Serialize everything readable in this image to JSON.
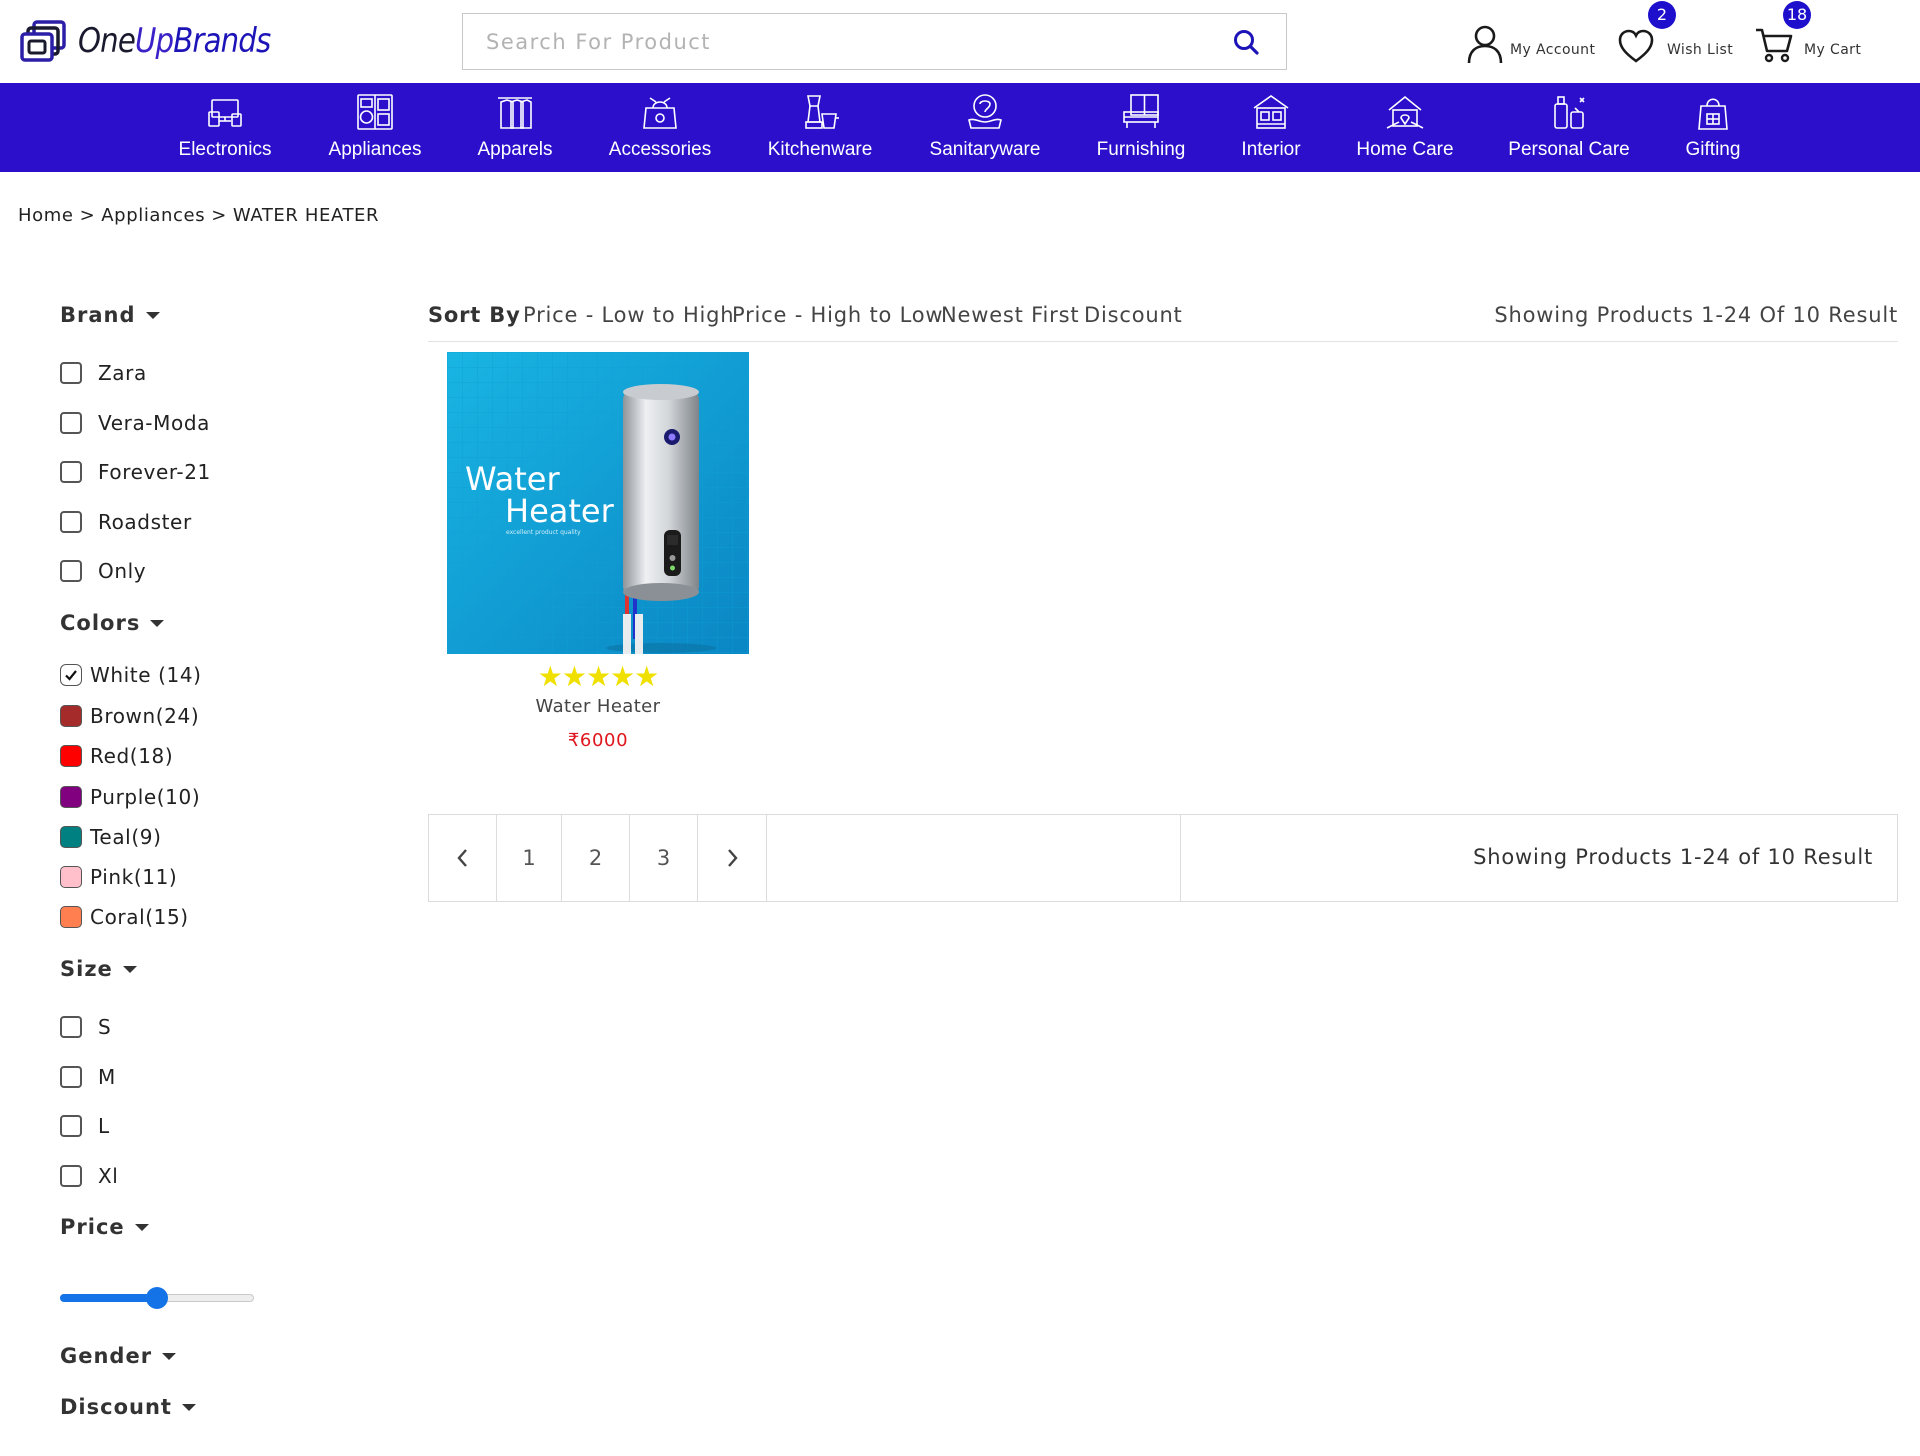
{
  "header": {
    "logo": {
      "one": "One",
      "up": "Up",
      "brands": "Brands"
    },
    "search": {
      "placeholder": "Search For Product",
      "value": "",
      "icon": "search-icon"
    },
    "actions": [
      {
        "label": "My Account",
        "icon": "user-icon"
      },
      {
        "label": "Wish List",
        "icon": "heart-icon",
        "badge": "2"
      },
      {
        "label": "My Cart",
        "icon": "cart-icon",
        "badge": "18"
      }
    ],
    "accent_color": "#2b0fcb"
  },
  "categories": [
    {
      "label": "Electronics",
      "icon": "electronics-icon"
    },
    {
      "label": "Appliances",
      "icon": "appliances-icon"
    },
    {
      "label": "Apparels",
      "icon": "apparels-icon"
    },
    {
      "label": "Accessories",
      "icon": "accessories-icon"
    },
    {
      "label": "Kitchenware",
      "icon": "kitchenware-icon"
    },
    {
      "label": "Sanitaryware",
      "icon": "sanitaryware-icon"
    },
    {
      "label": "Furnishing",
      "icon": "furnishing-icon"
    },
    {
      "label": "Interior",
      "icon": "interior-icon"
    },
    {
      "label": "Home Care",
      "icon": "home-care-icon"
    },
    {
      "label": "Personal Care",
      "icon": "personal-care-icon"
    },
    {
      "label": "Gifting",
      "icon": "gifting-icon"
    }
  ],
  "breadcrumb": {
    "items": [
      "Home",
      "Appliances",
      "WATER HEATER"
    ],
    "separator": ">"
  },
  "filters": {
    "brand": {
      "title": "Brand",
      "options": [
        {
          "label": "Zara",
          "checked": false
        },
        {
          "label": "Vera-Moda",
          "checked": false
        },
        {
          "label": "Forever-21",
          "checked": false
        },
        {
          "label": "Roadster",
          "checked": false
        },
        {
          "label": "Only",
          "checked": false
        }
      ]
    },
    "colors": {
      "title": "Colors",
      "options": [
        {
          "label": "White (14)",
          "color": "#ffffff",
          "checked": true
        },
        {
          "label": "Brown(24)",
          "color": "#a52a2a",
          "checked": false
        },
        {
          "label": "Red(18)",
          "color": "#ff0000",
          "checked": false
        },
        {
          "label": "Purple(10)",
          "color": "#800080",
          "checked": false
        },
        {
          "label": "Teal(9)",
          "color": "#008080",
          "checked": false
        },
        {
          "label": "Pink(11)",
          "color": "#ffc0cb",
          "checked": false
        },
        {
          "label": "Coral(15)",
          "color": "#ff7f50",
          "checked": false
        }
      ]
    },
    "size": {
      "title": "Size",
      "options": [
        {
          "label": "S",
          "checked": false
        },
        {
          "label": "M",
          "checked": false
        },
        {
          "label": "L",
          "checked": false
        },
        {
          "label": "Xl",
          "checked": false
        }
      ]
    },
    "price": {
      "title": "Price",
      "slider_fraction": 0.5
    },
    "gender": {
      "title": "Gender"
    },
    "discount": {
      "title": "Discount"
    }
  },
  "sort": {
    "title": "Sort By",
    "options": [
      "Price - Low to High",
      "Price - High to Low",
      "Newest First",
      "Discount"
    ],
    "results_text": "Showing Products 1-24 Of 10 Result"
  },
  "products": [
    {
      "name": "Water Heater",
      "price": "₹6000",
      "rating": 5,
      "stars": "★★★★★",
      "image_text": {
        "line1": "Water",
        "line2": "Heater",
        "tagline": "excellent product quality"
      }
    }
  ],
  "pagination": {
    "prev_icon": "chevron-left-icon",
    "next_icon": "chevron-right-icon",
    "pages": [
      "1",
      "2",
      "3"
    ],
    "results_text": "Showing Products 1-24 of 10 Result"
  }
}
